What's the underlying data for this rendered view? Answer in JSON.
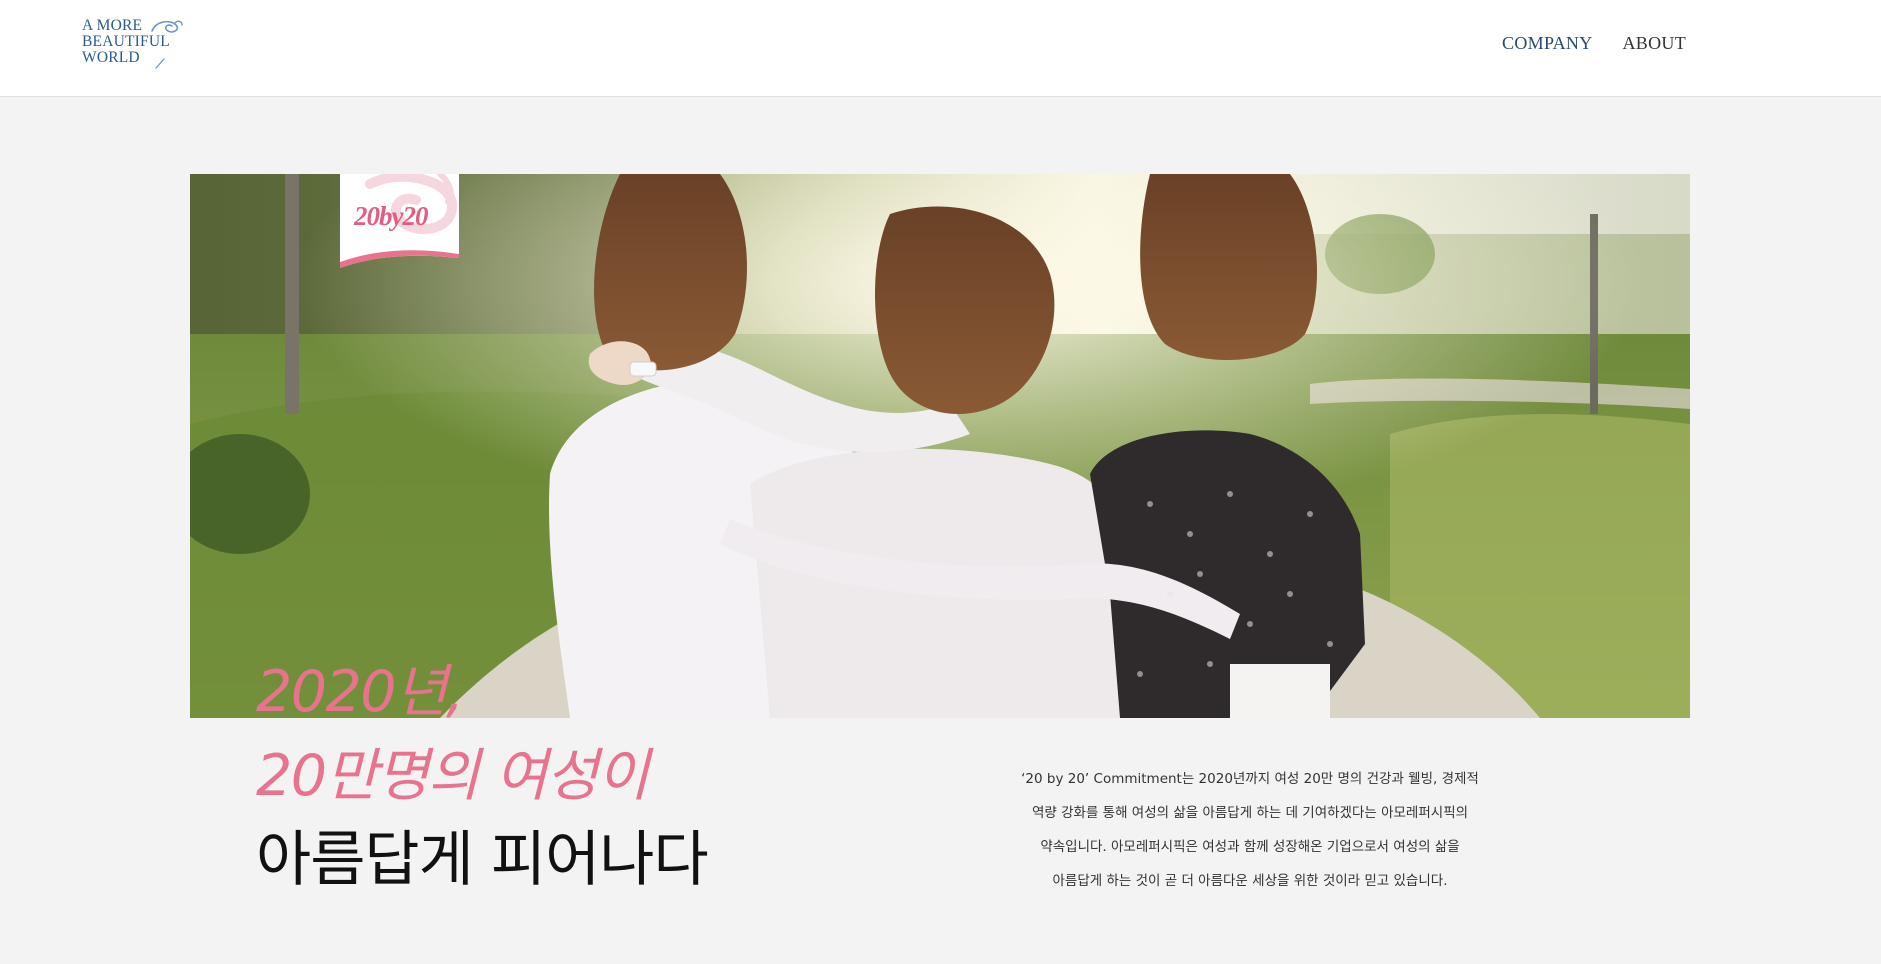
{
  "header": {
    "logo": {
      "lines": [
        "A MORE",
        "BEAUTIFUL",
        "WORLD"
      ],
      "icon": "swirl-icon"
    },
    "nav": [
      {
        "label": "COMPANY"
      },
      {
        "label": "ABOUT"
      }
    ]
  },
  "hero": {
    "badge_text": "20by20",
    "image_description_icon": "hero-photo"
  },
  "headline": {
    "line1": "2020년,",
    "line2": "20만명의 여성이",
    "line3": "아름답게 피어나다"
  },
  "description": {
    "lines": [
      "‘20 by 20’ Commitment는 2020년까지 여성 20만 명의 건강과 웰빙, 경제적",
      "역량 강화를 통해 여성의 삶을 아름답게 하는 데 기여하겠다는 아모레퍼시픽의",
      "약속입니다. 아모레퍼시픽은 여성과 함께 성장해온 기업으로서 여성의 삶을",
      "아름답게 하는 것이 곧 더 아름다운 세상을 위한 것이라 믿고 있습니다."
    ]
  },
  "colors": {
    "accent_pink": "#e9728f",
    "logo_blue": "#2b5a8f",
    "nav_text": "#2b4a6b",
    "page_bg": "#f3f3f3"
  }
}
